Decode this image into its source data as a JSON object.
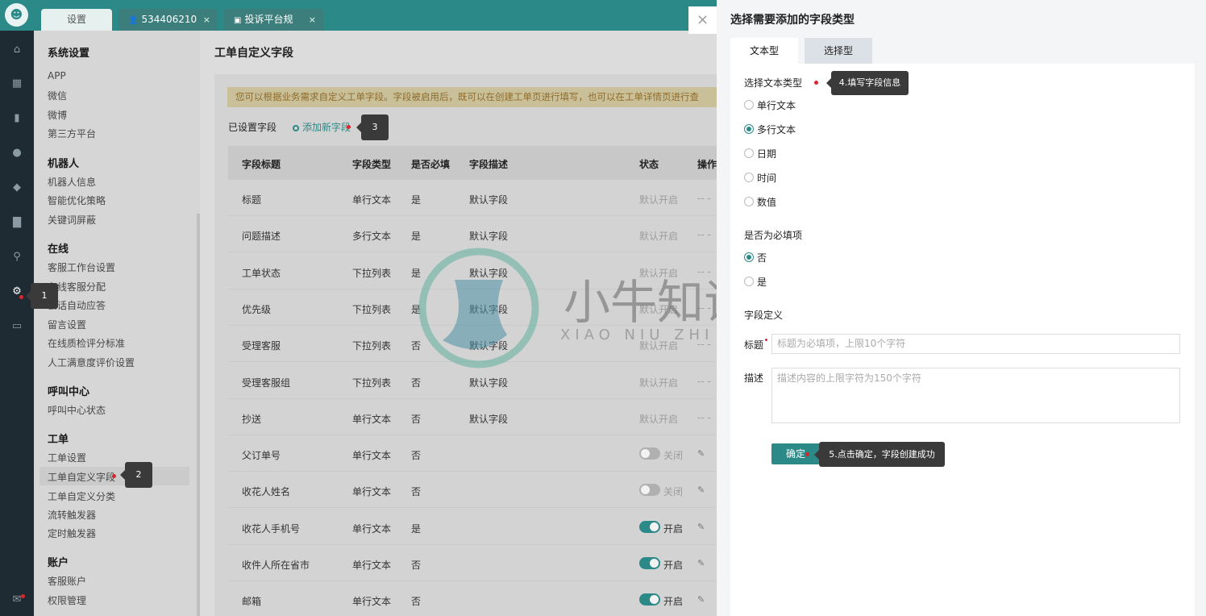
{
  "tabs": [
    {
      "label": "设置"
    },
    {
      "label": "534406210",
      "close": "×"
    },
    {
      "label": "投诉平台规",
      "close": "×"
    }
  ],
  "iconbar": {
    "icons": [
      "home-icon",
      "grid-icon",
      "book-icon",
      "user-icon",
      "users-icon",
      "bar-chart-icon",
      "search-icon",
      "gear-icon",
      "monitor-icon",
      "chat-icon"
    ]
  },
  "sidebar": {
    "sections": [
      {
        "title": "系统设置",
        "items": [
          "APP",
          "微信",
          "微博",
          "第三方平台"
        ]
      },
      {
        "title": "机器人",
        "items": [
          "机器人信息",
          "智能优化策略",
          "关键词屏蔽"
        ]
      },
      {
        "title": "在线",
        "items": [
          "客服工作台设置",
          "在线客服分配",
          "会话自动应答",
          "留言设置",
          "在线质检评分标准",
          "人工满意度评价设置"
        ]
      },
      {
        "title": "呼叫中心",
        "items": [
          "呼叫中心状态"
        ]
      },
      {
        "title": "工单",
        "items": [
          "工单设置",
          "工单自定义字段",
          "工单自定义分类",
          "流转触发器",
          "定时触发器"
        ]
      },
      {
        "title": "账户",
        "items": [
          "客服账户",
          "权限管理"
        ]
      }
    ]
  },
  "main": {
    "title": "工单自定义字段",
    "notice": "您可以根据业务需求自定义工单字段。字段被启用后，既可以在创建工单页进行填写，也可以在工单详情页进行查",
    "fields_label": "已设置字段",
    "add_link": "添加新字段",
    "columns": [
      "字段标题",
      "字段类型",
      "是否必填",
      "字段描述",
      "状态",
      "操作"
    ],
    "rows": [
      {
        "title": "标题",
        "type": "单行文本",
        "required": "是",
        "desc": "默认字段",
        "status": "默认开启",
        "toggle": null,
        "op": "-- -"
      },
      {
        "title": "问题描述",
        "type": "多行文本",
        "required": "是",
        "desc": "默认字段",
        "status": "默认开启",
        "toggle": null,
        "op": "-- -"
      },
      {
        "title": "工单状态",
        "type": "下拉列表",
        "required": "是",
        "desc": "默认字段",
        "status": "默认开启",
        "toggle": null,
        "op": "-- -"
      },
      {
        "title": "优先级",
        "type": "下拉列表",
        "required": "是",
        "desc": "默认字段",
        "status": "默认开启",
        "toggle": null,
        "op": "-- -"
      },
      {
        "title": "受理客服",
        "type": "下拉列表",
        "required": "否",
        "desc": "默认字段",
        "status": "默认开启",
        "toggle": null,
        "op": "-- -"
      },
      {
        "title": "受理客服组",
        "type": "下拉列表",
        "required": "否",
        "desc": "默认字段",
        "status": "默认开启",
        "toggle": null,
        "op": "-- -"
      },
      {
        "title": "抄送",
        "type": "单行文本",
        "required": "否",
        "desc": "默认字段",
        "status": "默认开启",
        "toggle": null,
        "op": "-- -"
      },
      {
        "title": "父订单号",
        "type": "单行文本",
        "required": "否",
        "desc": "",
        "status": "关闭",
        "toggle": "off",
        "op": ""
      },
      {
        "title": "收花人姓名",
        "type": "单行文本",
        "required": "否",
        "desc": "",
        "status": "关闭",
        "toggle": "off",
        "op": ""
      },
      {
        "title": "收花人手机号",
        "type": "单行文本",
        "required": "是",
        "desc": "",
        "status": "开启",
        "toggle": "on",
        "op": ""
      },
      {
        "title": "收件人所在省市",
        "type": "单行文本",
        "required": "否",
        "desc": "",
        "status": "开启",
        "toggle": "on",
        "op": ""
      },
      {
        "title": "邮箱",
        "type": "单行文本",
        "required": "否",
        "desc": "",
        "status": "开启",
        "toggle": "on",
        "op": ""
      }
    ]
  },
  "tooltips": {
    "t1": "1",
    "t2": "2",
    "t3": "3",
    "t4": "4.填写字段信息",
    "t5": "5.点击确定，字段创建成功"
  },
  "watermark": {
    "cn": "小牛知识库",
    "en": "XIAO NIU ZHI SHI KU"
  },
  "panel": {
    "close": "×",
    "title": "选择需要添加的字段类型",
    "tabs": [
      "文本型",
      "选择型"
    ],
    "text_type_label": "选择文本类型",
    "text_types": [
      "单行文本",
      "多行文本",
      "日期",
      "时间",
      "数值"
    ],
    "selected_text_type": "多行文本",
    "required_label": "是否为必填项",
    "required_options": [
      "否",
      "是"
    ],
    "required_value": "否",
    "definition_label": "字段定义",
    "title_label": "标题",
    "title_placeholder": "标题为必填项，上限10个字符",
    "desc_label": "描述",
    "desc_placeholder": "描述内容的上限字符为150个字符",
    "confirm": "确定"
  }
}
